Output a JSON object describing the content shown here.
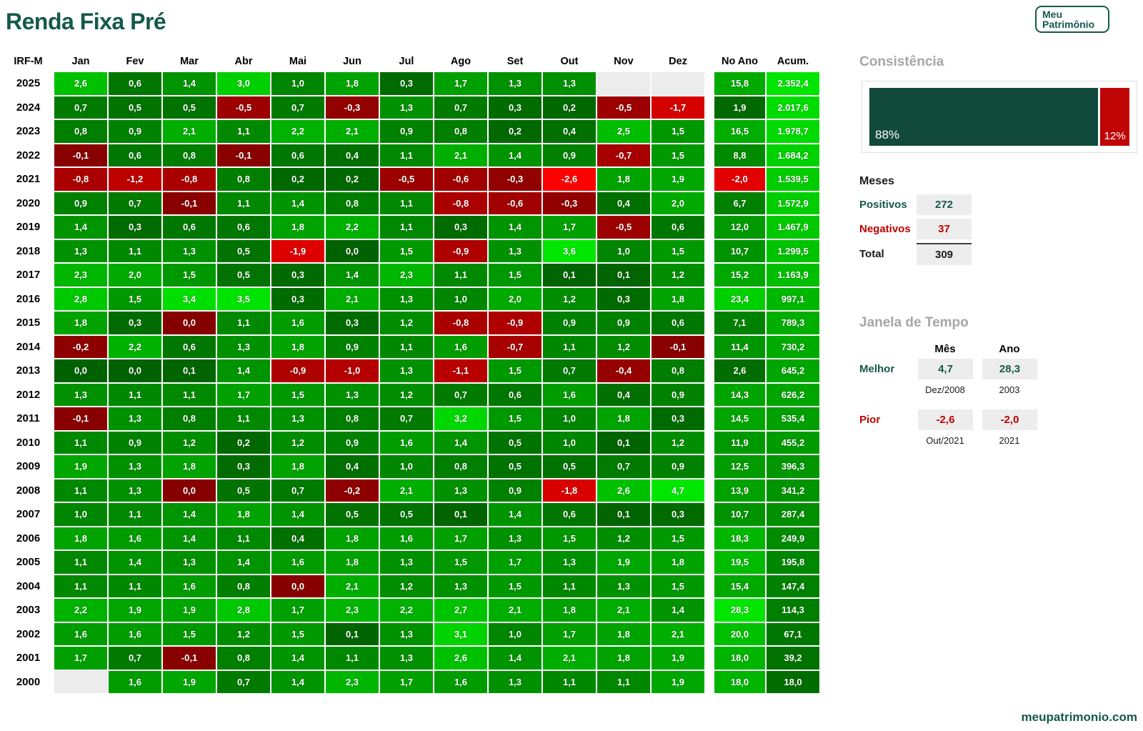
{
  "title": "Renda Fixa Pré",
  "logo": {
    "line1": "Meu",
    "line2": "Patrimônio"
  },
  "footer_link": "meupatrimonio.com",
  "colors": {
    "brand_teal": "#14594A",
    "negative_red": "#C00000",
    "bar_green": "#114A3B",
    "bar_red": "#C00505",
    "heading_gray": "#A6A6A6",
    "value_box_gray": "#EDEDED",
    "empty_cell": "#ECECEC"
  },
  "chart_data": {
    "type": "heatmap",
    "title": "Renda Fixa Pré",
    "index_header": "IRF-M",
    "month_columns": [
      "Jan",
      "Fev",
      "Mar",
      "Abr",
      "Mai",
      "Jun",
      "Jul",
      "Ago",
      "Set",
      "Out",
      "Nov",
      "Dez"
    ],
    "summary_columns": [
      "No Ano",
      "Acum."
    ],
    "rows": [
      {
        "year": "2025",
        "months": [
          "2,6",
          "0,6",
          "1,4",
          "3,0",
          "1,0",
          "1,8",
          "0,3",
          "1,7",
          "1,3",
          "1,3",
          "",
          ""
        ],
        "no_ano": "15,8",
        "acum": "2.352,4"
      },
      {
        "year": "2024",
        "months": [
          "0,7",
          "0,5",
          "0,5",
          "-0,5",
          "0,7",
          "-0,3",
          "1,3",
          "0,7",
          "0,3",
          "0,2",
          "-0,5",
          "-1,7"
        ],
        "no_ano": "1,9",
        "acum": "2.017,6"
      },
      {
        "year": "2023",
        "months": [
          "0,8",
          "0,9",
          "2,1",
          "1,1",
          "2,2",
          "2,1",
          "0,9",
          "0,8",
          "0,2",
          "0,4",
          "2,5",
          "1,5"
        ],
        "no_ano": "16,5",
        "acum": "1.978,7"
      },
      {
        "year": "2022",
        "months": [
          "-0,1",
          "0,6",
          "0,8",
          "-0,1",
          "0,6",
          "0,4",
          "1,1",
          "2,1",
          "1,4",
          "0,9",
          "-0,7",
          "1,5"
        ],
        "no_ano": "8,8",
        "acum": "1.684,2"
      },
      {
        "year": "2021",
        "months": [
          "-0,8",
          "-1,2",
          "-0,8",
          "0,8",
          "0,2",
          "0,2",
          "-0,5",
          "-0,6",
          "-0,3",
          "-2,6",
          "1,8",
          "1,9"
        ],
        "no_ano": "-2,0",
        "acum": "1.539,5"
      },
      {
        "year": "2020",
        "months": [
          "0,9",
          "0,7",
          "-0,1",
          "1,1",
          "1,4",
          "0,8",
          "1,1",
          "-0,8",
          "-0,6",
          "-0,3",
          "0,4",
          "2,0"
        ],
        "no_ano": "6,7",
        "acum": "1.572,9"
      },
      {
        "year": "2019",
        "months": [
          "1,4",
          "0,3",
          "0,6",
          "0,6",
          "1,8",
          "2,2",
          "1,1",
          "0,3",
          "1,4",
          "1,7",
          "-0,5",
          "0,6"
        ],
        "no_ano": "12,0",
        "acum": "1.467,9"
      },
      {
        "year": "2018",
        "months": [
          "1,3",
          "1,1",
          "1,3",
          "0,5",
          "-1,9",
          "0,0",
          "1,5",
          "-0,9",
          "1,3",
          "3,6",
          "1,0",
          "1,5"
        ],
        "no_ano": "10,7",
        "acum": "1.299,5"
      },
      {
        "year": "2017",
        "months": [
          "2,3",
          "2,0",
          "1,5",
          "0,5",
          "0,3",
          "1,4",
          "2,3",
          "1,1",
          "1,5",
          "0,1",
          "0,1",
          "1,2"
        ],
        "no_ano": "15,2",
        "acum": "1.163,9"
      },
      {
        "year": "2016",
        "months": [
          "2,8",
          "1,5",
          "3,4",
          "3,5",
          "0,3",
          "2,1",
          "1,3",
          "1,0",
          "2,0",
          "1,2",
          "0,3",
          "1,8"
        ],
        "no_ano": "23,4",
        "acum": "997,1"
      },
      {
        "year": "2015",
        "months": [
          "1,8",
          "0,3",
          "0,0",
          "1,1",
          "1,6",
          "0,3",
          "1,2",
          "-0,8",
          "-0,9",
          "0,9",
          "0,9",
          "0,6"
        ],
        "neg_zero_months": [
          2
        ],
        "no_ano": "7,1",
        "acum": "789,3"
      },
      {
        "year": "2014",
        "months": [
          "-0,2",
          "2,2",
          "0,6",
          "1,3",
          "1,8",
          "0,9",
          "1,1",
          "1,6",
          "-0,7",
          "1,1",
          "1,2",
          "-0,1"
        ],
        "no_ano": "11,4",
        "acum": "730,2"
      },
      {
        "year": "2013",
        "months": [
          "0,0",
          "0,0",
          "0,1",
          "1,4",
          "-0,9",
          "-1,0",
          "1,3",
          "-1,1",
          "1,5",
          "0,7",
          "-0,4",
          "0,8"
        ],
        "no_ano": "2,6",
        "acum": "645,2"
      },
      {
        "year": "2012",
        "months": [
          "1,3",
          "1,1",
          "1,1",
          "1,7",
          "1,5",
          "1,3",
          "1,2",
          "0,7",
          "0,6",
          "1,6",
          "0,4",
          "0,9"
        ],
        "no_ano": "14,3",
        "acum": "626,2"
      },
      {
        "year": "2011",
        "months": [
          "-0,1",
          "1,3",
          "0,8",
          "1,1",
          "1,3",
          "0,8",
          "0,7",
          "3,2",
          "1,5",
          "1,0",
          "1,8",
          "0,3"
        ],
        "no_ano": "14,5",
        "acum": "535,4"
      },
      {
        "year": "2010",
        "months": [
          "1,1",
          "0,9",
          "1,2",
          "0,2",
          "1,2",
          "0,9",
          "1,6",
          "1,4",
          "0,5",
          "1,0",
          "0,1",
          "1,2"
        ],
        "no_ano": "11,9",
        "acum": "455,2"
      },
      {
        "year": "2009",
        "months": [
          "1,9",
          "1,3",
          "1,8",
          "0,3",
          "1,8",
          "0,4",
          "1,0",
          "0,8",
          "0,5",
          "0,5",
          "0,7",
          "0,9"
        ],
        "no_ano": "12,5",
        "acum": "396,3"
      },
      {
        "year": "2008",
        "months": [
          "1,1",
          "1,3",
          "0,0",
          "0,5",
          "0,7",
          "-0,2",
          "2,1",
          "1,3",
          "0,9",
          "-1,8",
          "2,6",
          "4,7"
        ],
        "neg_zero_months": [
          2
        ],
        "no_ano": "13,9",
        "acum": "341,2"
      },
      {
        "year": "2007",
        "months": [
          "1,0",
          "1,1",
          "1,4",
          "1,8",
          "1,4",
          "0,5",
          "0,5",
          "0,1",
          "1,4",
          "0,6",
          "0,1",
          "0,3"
        ],
        "no_ano": "10,7",
        "acum": "287,4"
      },
      {
        "year": "2006",
        "months": [
          "1,8",
          "1,6",
          "1,4",
          "1,1",
          "0,4",
          "1,8",
          "1,6",
          "1,7",
          "1,3",
          "1,5",
          "1,2",
          "1,5"
        ],
        "no_ano": "18,3",
        "acum": "249,9"
      },
      {
        "year": "2005",
        "months": [
          "1,1",
          "1,4",
          "1,3",
          "1,4",
          "1,6",
          "1,8",
          "1,3",
          "1,5",
          "1,7",
          "1,3",
          "1,9",
          "1,8"
        ],
        "no_ano": "19,5",
        "acum": "195,8"
      },
      {
        "year": "2004",
        "months": [
          "1,1",
          "1,1",
          "1,6",
          "0,8",
          "0,0",
          "2,1",
          "1,2",
          "1,3",
          "1,5",
          "1,1",
          "1,3",
          "1,5"
        ],
        "neg_zero_months": [
          4
        ],
        "no_ano": "15,4",
        "acum": "147,4"
      },
      {
        "year": "2003",
        "months": [
          "2,2",
          "1,9",
          "1,9",
          "2,8",
          "1,7",
          "2,3",
          "2,2",
          "2,7",
          "2,1",
          "1,8",
          "2,1",
          "1,4"
        ],
        "no_ano": "28,3",
        "acum": "114,3"
      },
      {
        "year": "2002",
        "months": [
          "1,6",
          "1,6",
          "1,5",
          "1,2",
          "1,5",
          "0,1",
          "1,3",
          "3,1",
          "1,0",
          "1,7",
          "1,8",
          "2,1"
        ],
        "no_ano": "20,0",
        "acum": "67,1"
      },
      {
        "year": "2001",
        "months": [
          "1,7",
          "0,7",
          "-0,1",
          "0,8",
          "1,4",
          "1,1",
          "1,3",
          "2,6",
          "1,4",
          "2,1",
          "1,8",
          "1,9"
        ],
        "no_ano": "18,0",
        "acum": "39,2"
      },
      {
        "year": "2000",
        "months": [
          "",
          "1,6",
          "1,9",
          "0,7",
          "1,4",
          "2,3",
          "1,7",
          "1,6",
          "1,3",
          "1,1",
          "1,1",
          "1,9"
        ],
        "no_ano": "18,0",
        "acum": "18,0"
      }
    ],
    "color_scale": {
      "positive_month_max": "3,6",
      "negative_month_max": "-2,6",
      "no_ano_max": "28,3",
      "acum_max": "2.352,4"
    }
  },
  "sidebar": {
    "consistencia": {
      "heading": "Consistência",
      "positivo_pct": "88%",
      "negativo_pct": "12%"
    },
    "meses": {
      "heading": "Meses",
      "positivos_label": "Positivos",
      "positivos_value": "272",
      "negativos_label": "Negativos",
      "negativos_value": "37",
      "total_label": "Total",
      "total_value": "309"
    },
    "janela": {
      "heading": "Janela de Tempo",
      "mes_header": "Mês",
      "ano_header": "Ano",
      "melhor_label": "Melhor",
      "melhor_mes": "4,7",
      "melhor_mes_sub": "Dez/2008",
      "melhor_ano": "28,3",
      "melhor_ano_sub": "2003",
      "pior_label": "Pior",
      "pior_mes": "-2,6",
      "pior_mes_sub": "Out/2021",
      "pior_ano": "-2,0",
      "pior_ano_sub": "2021"
    }
  }
}
